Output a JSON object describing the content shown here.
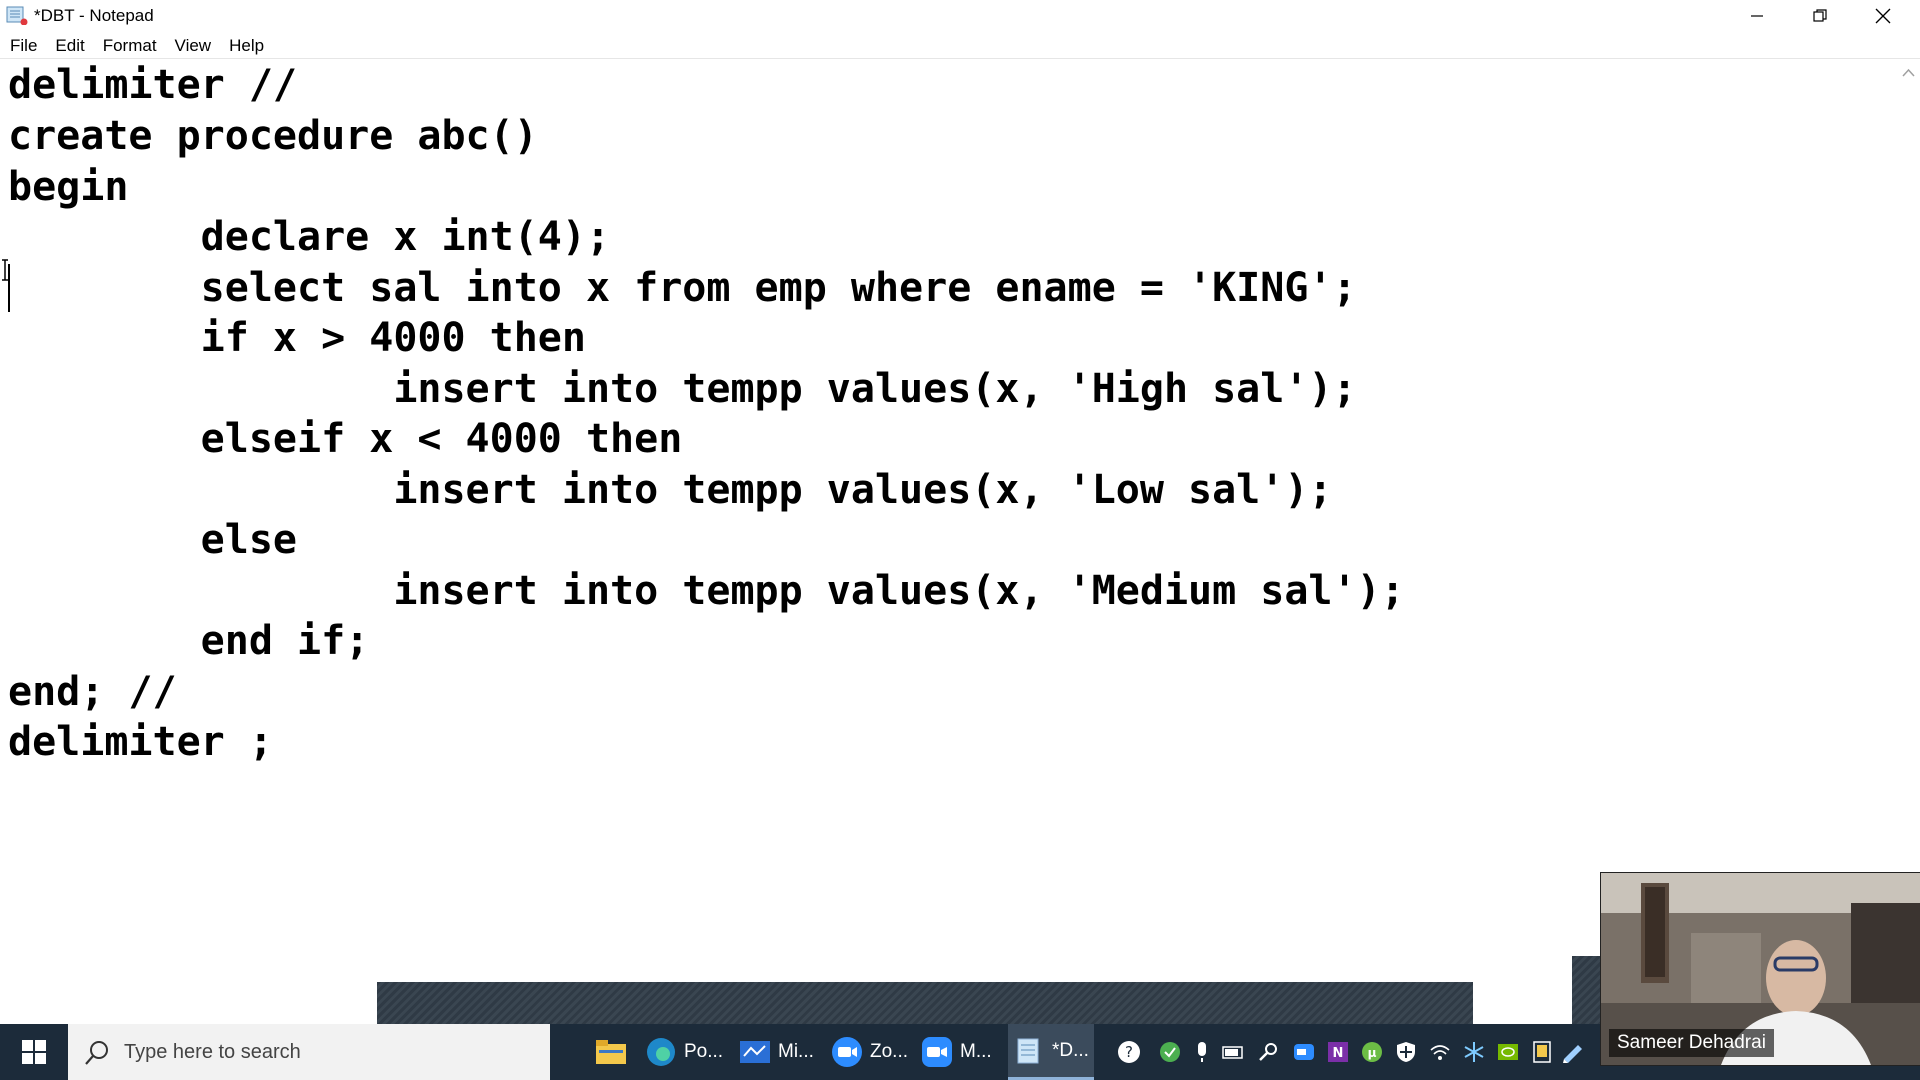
{
  "window": {
    "title": "*DBT - Notepad",
    "menu": [
      "File",
      "Edit",
      "Format",
      "View",
      "Help"
    ]
  },
  "editor": {
    "lines": [
      "delimiter //",
      "create procedure abc()",
      "begin",
      "        declare x int(4);",
      "        select sal into x from emp where ename = 'KING';",
      "        if x > 4000 then",
      "                insert into tempp values(x, 'High sal');",
      "        elseif x < 4000 then",
      "                insert into tempp values(x, 'Low sal');",
      "        else",
      "                insert into tempp values(x, 'Medium sal');",
      "        end if;",
      "end; //",
      "delimiter ;"
    ]
  },
  "taskbar": {
    "search_placeholder": "Type here to search",
    "apps": [
      {
        "icon": "file-explorer-icon",
        "label": ""
      },
      {
        "icon": "edge-icon",
        "label": "Po..."
      },
      {
        "icon": "whiteboard-icon",
        "label": "Mi..."
      },
      {
        "icon": "zoom-icon",
        "label": "Zo..."
      },
      {
        "icon": "zoom-meeting-icon",
        "label": "M..."
      },
      {
        "icon": "notepad-icon",
        "label": "*D..."
      }
    ],
    "tray_icons": [
      "help-icon",
      "check-icon",
      "microphone-icon",
      "battery-icon",
      "steam-icon",
      "zoom-tray-icon",
      "onenote-icon",
      "torrent-icon",
      "shield-icon",
      "wifi-icon",
      "snowflake-icon",
      "nvidia-icon",
      "tablet-icon",
      "pen-icon"
    ]
  },
  "video": {
    "participant_name": "Sameer Dehadrai"
  },
  "colors": {
    "taskbar": "#1c2b3a",
    "accent": "#8fb3d9"
  }
}
